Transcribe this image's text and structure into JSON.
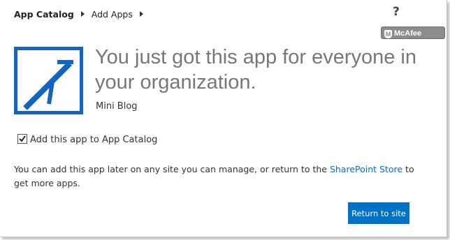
{
  "breadcrumb": {
    "root": "App Catalog",
    "current": "Add Apps"
  },
  "help": {
    "label": "?"
  },
  "mcafee_badge": {
    "label": "McAfee",
    "icon": "shield-icon"
  },
  "app": {
    "icon": "mini-blog-app-icon",
    "headline": "You just got this app for everyone in your organization.",
    "name": "Mini Blog"
  },
  "catalog_option": {
    "checked": true,
    "label": "Add this app to App Catalog"
  },
  "info": {
    "text_before": "You can add this app later on any site you can manage, or return to the ",
    "store_link": "SharePoint Store",
    "text_after": " to get more apps."
  },
  "actions": {
    "return_label": "Return to site"
  },
  "colors": {
    "accent": "#0072c6",
    "headline": "#777777"
  }
}
